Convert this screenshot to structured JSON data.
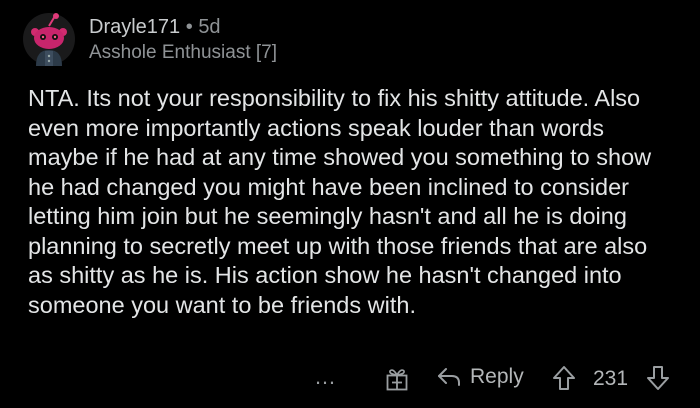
{
  "comment": {
    "author": "Drayle171",
    "separator": "•",
    "age": "5d",
    "flair": "Asshole Enthusiast [7]",
    "body": "NTA. Its not your responsibility to fix his shitty attitude. Also even more importantly actions speak louder than words maybe if he had at any time showed you something to show he had changed you might have been inclined to consider letting him join but he seemingly hasn't and all he is doing planning to secretly meet up with those friends that are also as shitty as he is. His action show he hasn't changed into someone you want to be friends with."
  },
  "actions": {
    "more_icon": "…",
    "award_icon": "gift-icon",
    "reply_icon": "reply-arrow-icon",
    "reply_label": "Reply",
    "upvote_icon": "upvote-arrow-icon",
    "score": "231",
    "downvote_icon": "downvote-arrow-icon"
  },
  "colors": {
    "background": "#000000",
    "text": "#e3e5e6",
    "meta": "#8f9396",
    "avatar_accent": "#c8256c"
  }
}
